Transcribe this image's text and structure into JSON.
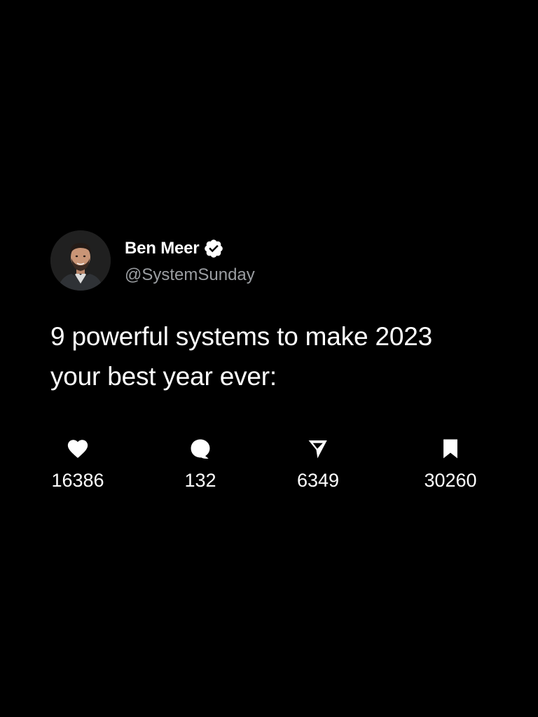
{
  "author": {
    "display_name": "Ben Meer",
    "handle": "@SystemSunday",
    "verified": true
  },
  "tweet": {
    "text_line_1": "9 powerful systems to make 2023",
    "text_line_2": "your best year ever:"
  },
  "stats": {
    "likes": "16386",
    "replies": "132",
    "shares": "6349",
    "bookmarks": "30260"
  },
  "icons": {
    "likes": "heart-icon",
    "replies": "speech-bubble-icon",
    "shares": "paper-plane-icon",
    "bookmarks": "bookmark-icon",
    "verified": "verified-badge-icon"
  },
  "colors": {
    "background": "#000000",
    "text": "#ffffff",
    "handle": "#9b9ea2"
  }
}
